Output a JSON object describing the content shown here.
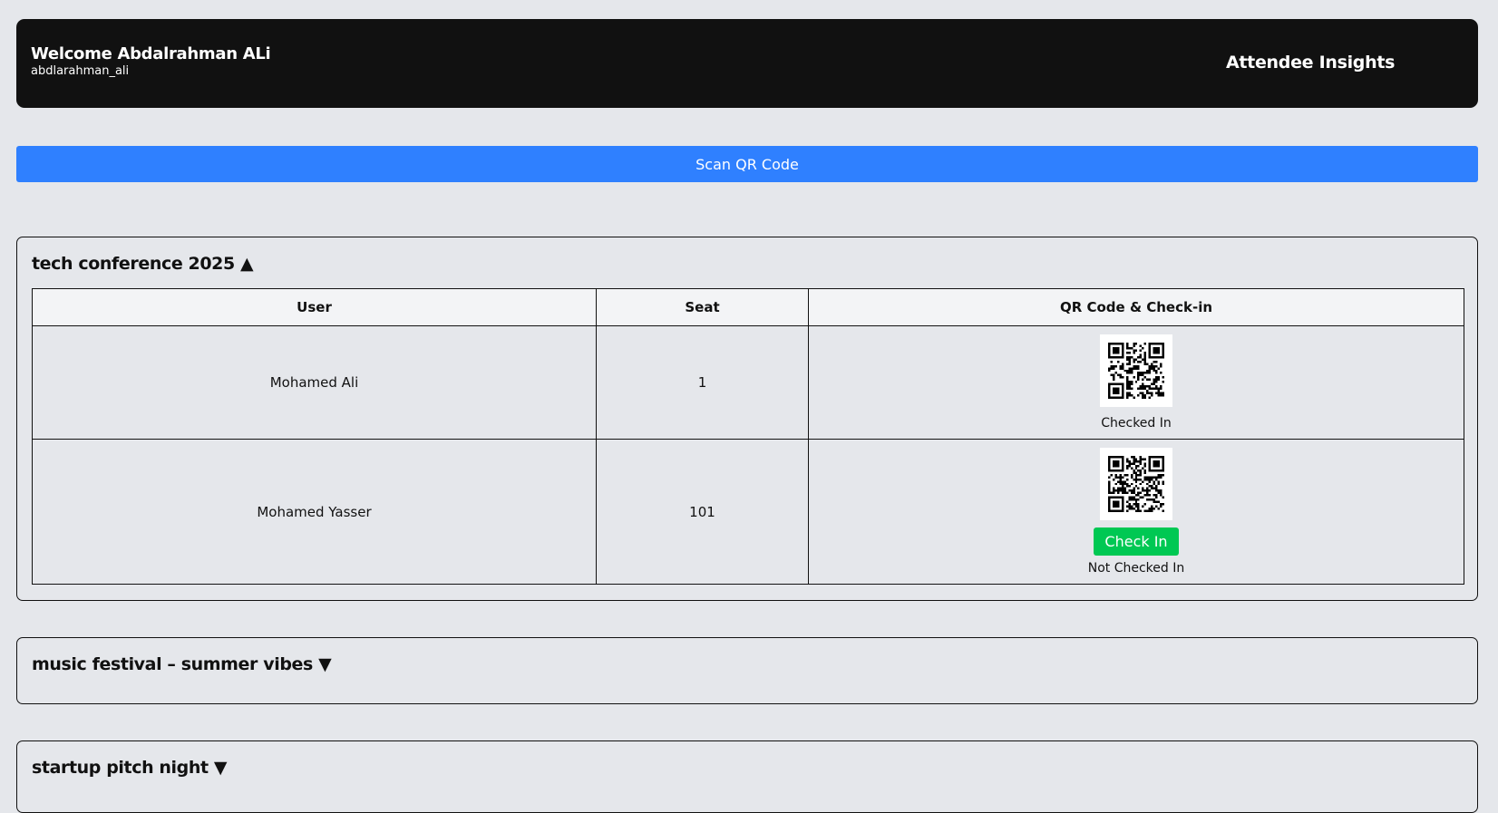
{
  "header": {
    "welcome": "Welcome Abdalrahman ALi",
    "username": "abdlarahman_ali",
    "insights": "Attendee Insights"
  },
  "scan_button": "Scan QR Code",
  "events": [
    {
      "title": "tech conference 2025 ▲",
      "columns": [
        "User",
        "Seat",
        "QR Code & Check-in"
      ],
      "rows": [
        {
          "user": "Mohamed Ali",
          "seat": "1",
          "status": "Checked In"
        },
        {
          "user": "Mohamed Yasser",
          "seat": "101",
          "button": "Check In",
          "status": "Not Checked In"
        }
      ]
    },
    {
      "title": "music festival – summer vibes ▼"
    },
    {
      "title": "startup pitch night ▼"
    }
  ],
  "colors": {
    "background": "#e5e7eb",
    "header_bg": "#111111",
    "primary": "#2f80ff",
    "success": "#00c853"
  }
}
